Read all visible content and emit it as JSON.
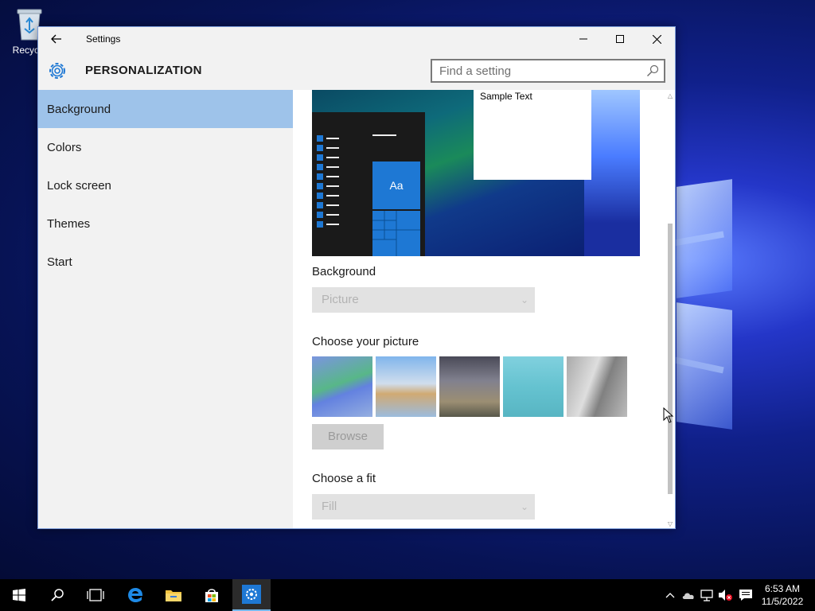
{
  "desktop": {
    "recycle_bin_label": "Recycle"
  },
  "window": {
    "title": "Settings",
    "section_title": "PERSONALIZATION",
    "search_placeholder": "Find a setting"
  },
  "sidebar": {
    "items": [
      {
        "label": "Background",
        "active": true
      },
      {
        "label": "Colors",
        "active": false
      },
      {
        "label": "Lock screen",
        "active": false
      },
      {
        "label": "Themes",
        "active": false
      },
      {
        "label": "Start",
        "active": false
      }
    ]
  },
  "content": {
    "preview": {
      "sample_text": "Sample Text",
      "tile_label": "Aa"
    },
    "background_label": "Background",
    "background_value": "Picture",
    "choose_picture_label": "Choose your picture",
    "browse_label": "Browse",
    "choose_fit_label": "Choose a fit",
    "fit_value": "Fill"
  },
  "taskbar": {
    "time": "6:53 AM",
    "date": "11/5/2022"
  },
  "colors": {
    "accent": "#1e78d4",
    "selected_nav": "#9ec3ea",
    "window_chrome": "#f2f2f2"
  }
}
